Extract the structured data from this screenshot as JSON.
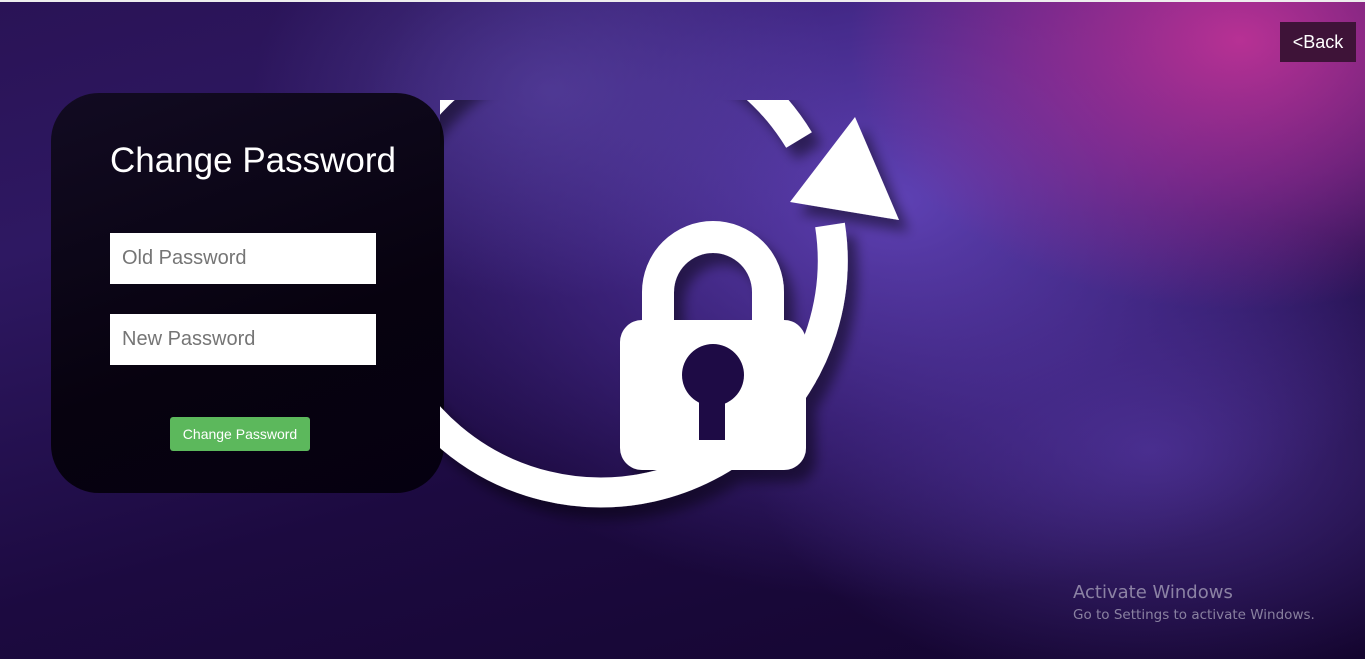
{
  "header": {
    "back_label": "<Back"
  },
  "form": {
    "title": "Change Password",
    "old_password": {
      "placeholder": "Old Password",
      "value": ""
    },
    "new_password": {
      "placeholder": "New Password",
      "value": ""
    },
    "submit_label": "Change Password"
  },
  "hero": {
    "icon": "lock-refresh-icon"
  },
  "watermark": {
    "title": "Activate Windows",
    "subtitle": "Go to Settings to activate Windows."
  },
  "colors": {
    "accent_button": "#5cb85c",
    "back_button": "#3e1338",
    "card_background": "#07020f",
    "background_pink": "#b0328f",
    "background_purple": "#2a1356"
  }
}
